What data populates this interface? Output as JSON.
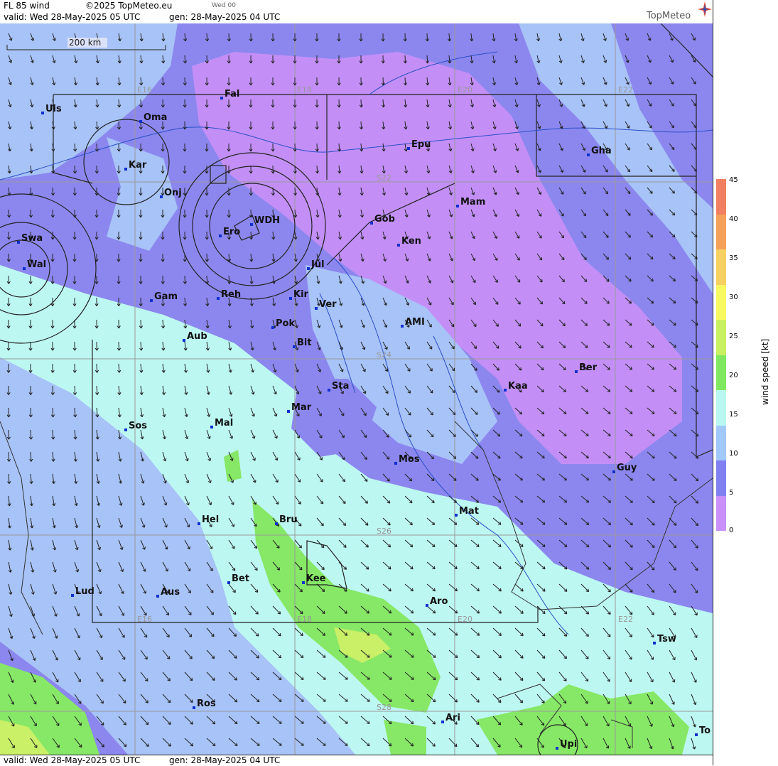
{
  "header": {
    "title": "FL 85 wind",
    "copyright": "©2025 TopMeteo.eu",
    "day_code": "Wed 00",
    "valid": "valid:  Wed  28-May-2025  05 UTC",
    "generated": "gen:  28-May-2025 04 UTC",
    "logo": "TopMeteo"
  },
  "footer": {
    "valid": "valid:  Wed  28-May-2025  05 UTC",
    "generated": "gen:  28-May-2025  04 UTC"
  },
  "scale_bar": "200 km",
  "legend": {
    "title": "wind  speed  [kt]",
    "ticks": [
      "45",
      "40",
      "35",
      "30",
      "25",
      "20",
      "15",
      "10",
      "5",
      "0"
    ],
    "colors": [
      "#f08060",
      "#f5a05a",
      "#f6d060",
      "#f8f860",
      "#c8f060",
      "#80e860",
      "#b8f8f0",
      "#a0c8f8",
      "#8080f0",
      "#c890f8"
    ]
  },
  "grid_labels": {
    "top": [
      "E16",
      "E18",
      "E20",
      "E22"
    ],
    "bottom": [
      "E16",
      "E18",
      "E20",
      "E22"
    ],
    "lat": [
      "S22",
      "S24",
      "S26",
      "S28"
    ]
  },
  "places": [
    {
      "name": "Uis"
    },
    {
      "name": "Oma"
    },
    {
      "name": "Fal"
    },
    {
      "name": "Kar"
    },
    {
      "name": "Onj"
    },
    {
      "name": "Epu"
    },
    {
      "name": "Gha"
    },
    {
      "name": "Mam"
    },
    {
      "name": "Gob"
    },
    {
      "name": "Ken"
    },
    {
      "name": "Swa"
    },
    {
      "name": "Wal"
    },
    {
      "name": "Ero"
    },
    {
      "name": "WDH"
    },
    {
      "name": "Jul"
    },
    {
      "name": "Gam"
    },
    {
      "name": "Reh"
    },
    {
      "name": "Kir"
    },
    {
      "name": "Ver"
    },
    {
      "name": "Pok"
    },
    {
      "name": "AMI"
    },
    {
      "name": "Aub"
    },
    {
      "name": "Bit"
    },
    {
      "name": "Ber"
    },
    {
      "name": "Sta"
    },
    {
      "name": "Kaa"
    },
    {
      "name": "Mar"
    },
    {
      "name": "Sos"
    },
    {
      "name": "Mal"
    },
    {
      "name": "Mos"
    },
    {
      "name": "Guy"
    },
    {
      "name": "Mat"
    },
    {
      "name": "Hel"
    },
    {
      "name": "Bru"
    },
    {
      "name": "Bet"
    },
    {
      "name": "Kee"
    },
    {
      "name": "Lud"
    },
    {
      "name": "Aus"
    },
    {
      "name": "Aro"
    },
    {
      "name": "Tsw"
    },
    {
      "name": "Ros"
    },
    {
      "name": "Ari"
    },
    {
      "name": "Upi"
    },
    {
      "name": "To"
    }
  ]
}
